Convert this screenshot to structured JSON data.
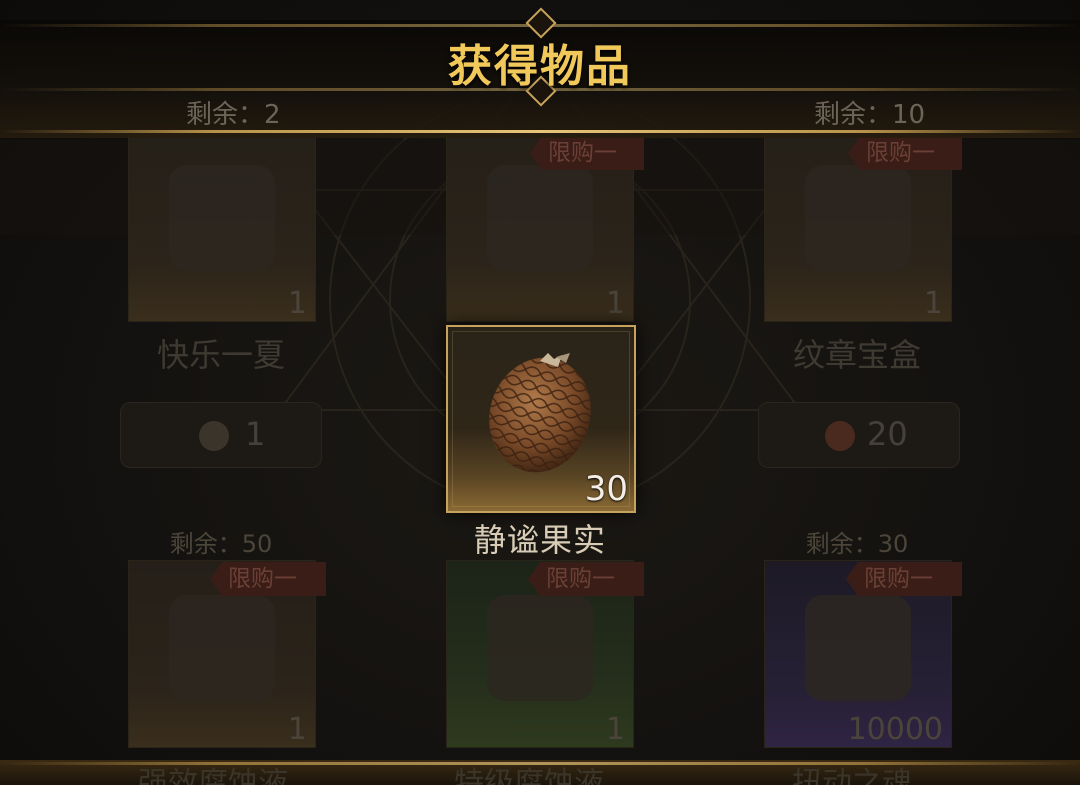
{
  "header": {
    "title": "获得物品",
    "remain_left": "剩余：2",
    "remain_right": "剩余：10"
  },
  "reward": {
    "name": "静谧果实",
    "quantity": "30",
    "icon": "pinecone-fruit-icon"
  },
  "shop": {
    "row1": [
      {
        "name": "快乐一夏",
        "qty": "1",
        "price": "1",
        "ribbon": ""
      },
      {
        "name": "",
        "qty": "1",
        "price": "",
        "ribbon": "限购一次"
      },
      {
        "name": "纹章宝盒",
        "qty": "1",
        "price": "20",
        "ribbon": "限购一次"
      }
    ],
    "row2": [
      {
        "remain": "剩余：50",
        "qty": "1",
        "ribbon": "限购一次",
        "name": "强效腐蚀液"
      },
      {
        "remain": "",
        "qty": "1",
        "ribbon": "限购一次",
        "name": "特级腐蚀液"
      },
      {
        "remain": "剩余：30",
        "qty": "10000",
        "ribbon": "限购一次",
        "name": "扭动之魂"
      }
    ]
  },
  "colors": {
    "title_gold": "#f1c95a",
    "frame_gold": "#c7a25c",
    "ribbon_red": "#3a1d17"
  }
}
